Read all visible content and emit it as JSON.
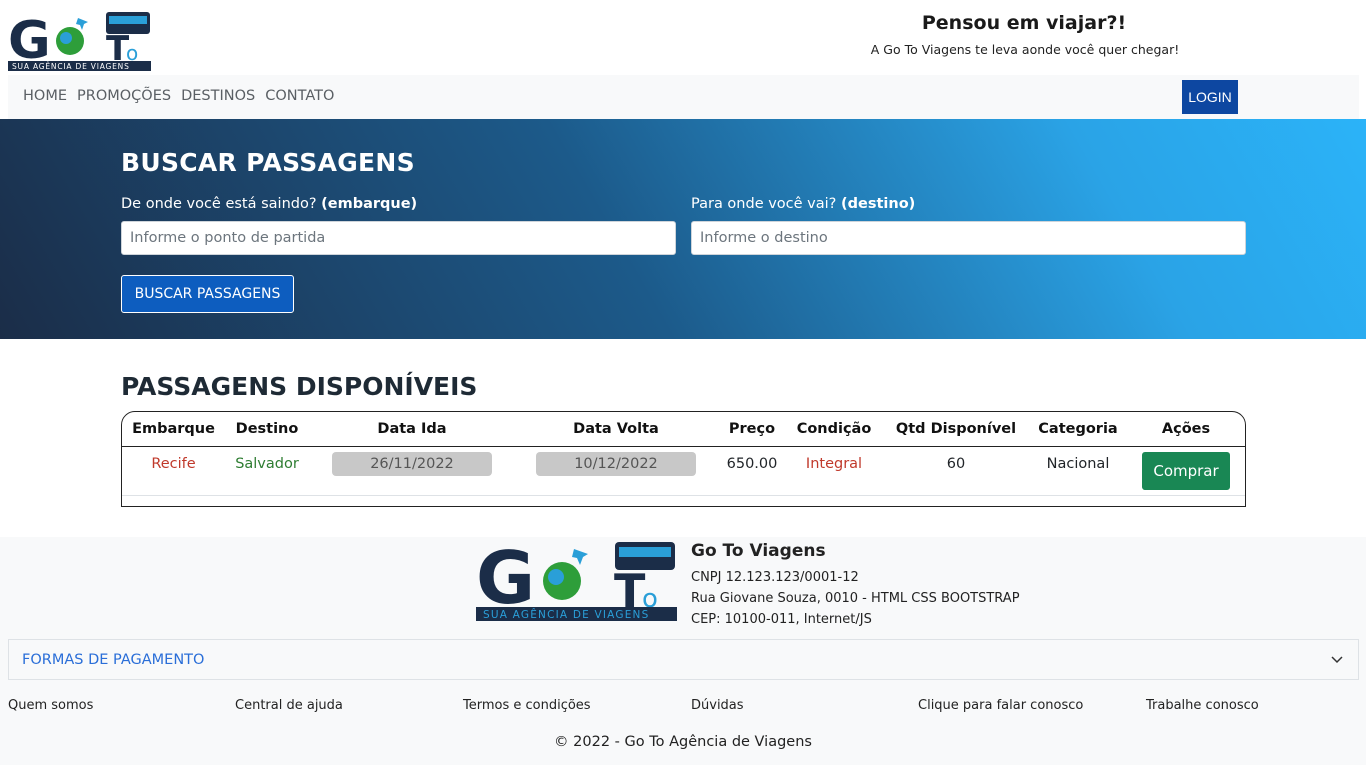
{
  "brand": {
    "logo_letters_g": "G",
    "logo_letters_o": "o",
    "logo_letters_t": "T",
    "logo_letters_o2": "o",
    "logo_tagline": "SUA AGÊNCIA DE VIAGENS",
    "colors": {
      "navy": "#1b2d48",
      "green": "#2e9e3a",
      "blue": "#2a9fd8"
    }
  },
  "header": {
    "title": "Pensou em viajar?!",
    "subtitle": "A Go To Viagens te leva aonde você quer chegar!"
  },
  "nav": {
    "items": [
      "HOME",
      "PROMOÇÕES",
      "DESTINOS",
      "CONTATO"
    ],
    "login_label": "LOGIN"
  },
  "search": {
    "title": "BUSCAR PASSAGENS",
    "origin_label": "De onde você está saindo?",
    "origin_label_bold": "(embarque)",
    "origin_placeholder": "Informe o ponto de partida",
    "destination_label": "Para onde você vai?",
    "destination_label_bold": "(destino)",
    "destination_placeholder": "Informe o destino",
    "button_label": "BUSCAR PASSAGENS"
  },
  "tickets": {
    "title": "PASSAGENS DISPONÍVEIS",
    "columns": [
      "Embarque",
      "Destino",
      "Data Ida",
      "Data Volta",
      "Preço",
      "Condição",
      "Qtd Disponível",
      "Categoria",
      "Ações"
    ],
    "rows": [
      {
        "embarque": "Recife",
        "destino": "Salvador",
        "data_ida": "26/11/2022",
        "data_volta": "10/12/2022",
        "preco": "650.00",
        "condicao": "Integral",
        "qtd": "60",
        "categoria": "Nacional",
        "acao": "Comprar"
      }
    ]
  },
  "footer": {
    "company_name": "Go To Viagens",
    "cnpj": "CNPJ 12.123.123/0001-12",
    "address": "Rua Giovane Souza, 0010 - HTML CSS BOOTSTRAP",
    "cep": "CEP: 10100-011, Internet/JS",
    "payment_label": "FORMAS DE PAGAMENTO",
    "links": [
      "Quem somos",
      "Central de ajuda",
      "Termos e condições",
      "Dúvidas",
      "Clique para falar conosco",
      "Trabalhe conosco"
    ],
    "copyright": "© 2022 - Go To Agência de Viagens"
  }
}
